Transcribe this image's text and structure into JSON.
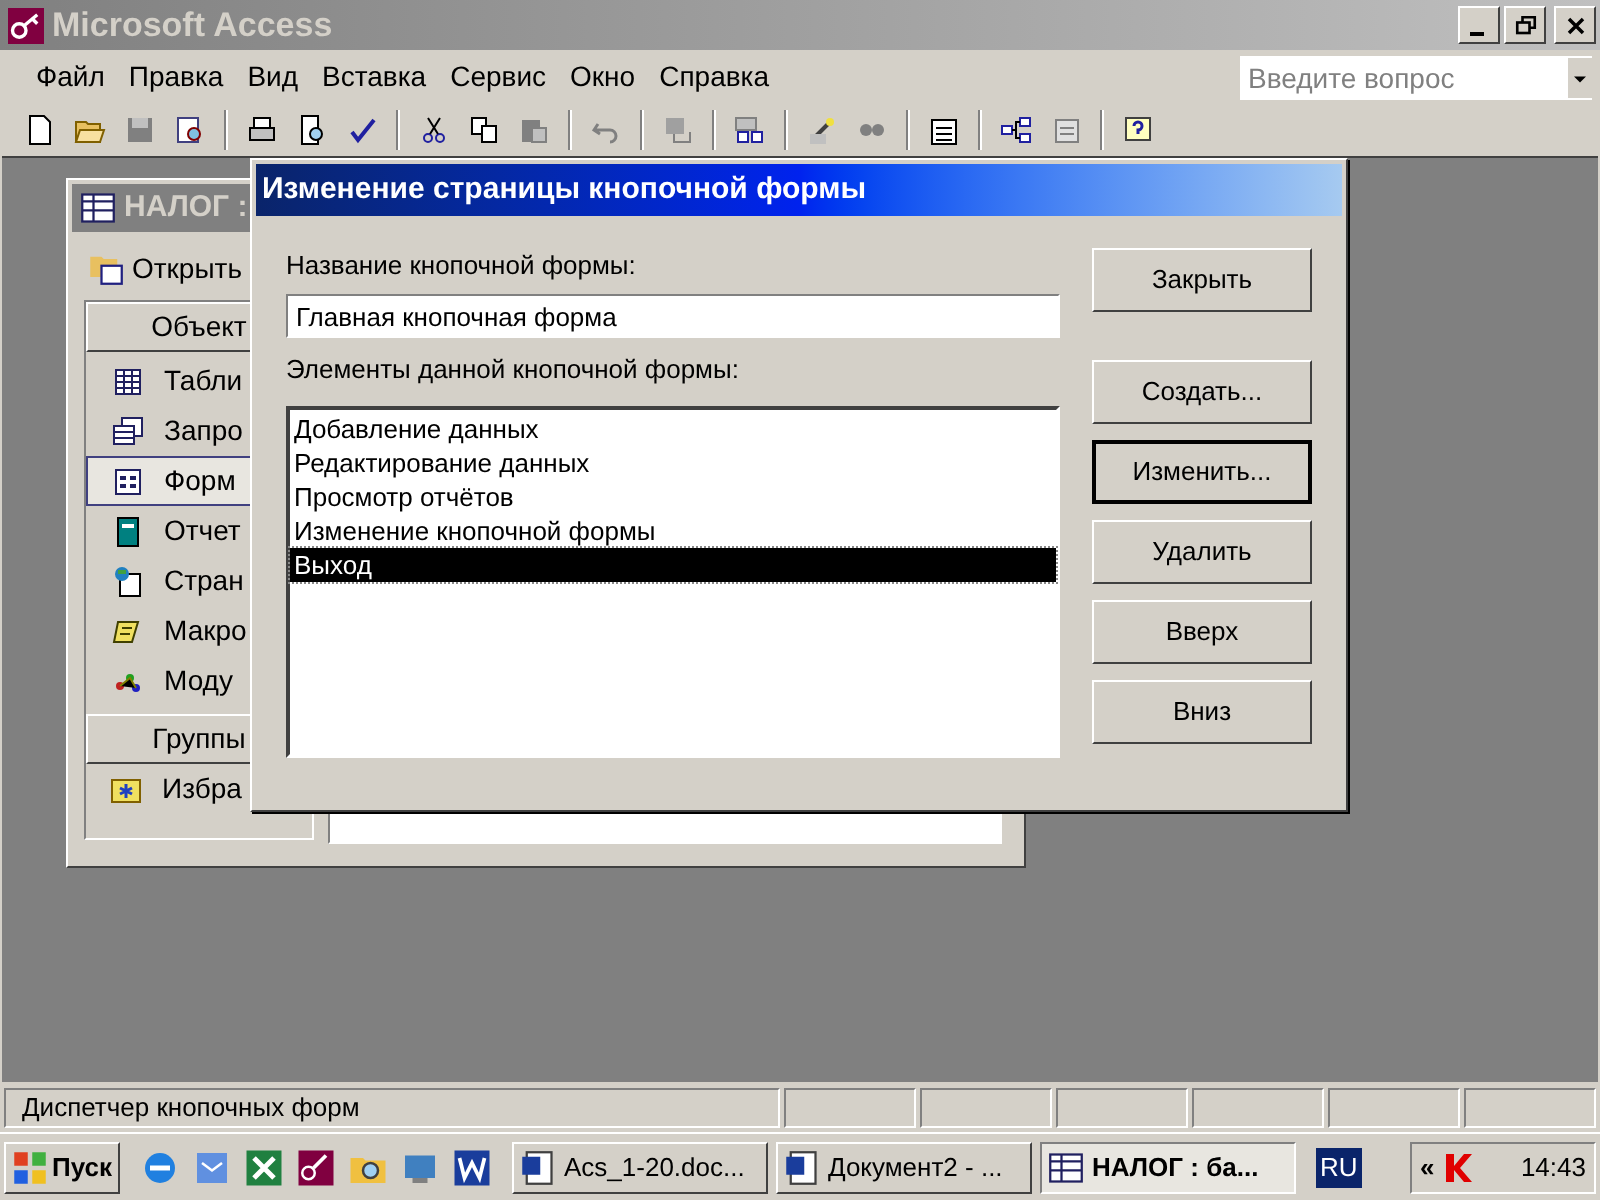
{
  "window": {
    "title": "Microsoft Access"
  },
  "menu": [
    {
      "label": "Файл"
    },
    {
      "label": "Правка"
    },
    {
      "label": "Вид"
    },
    {
      "label": "Вставка"
    },
    {
      "label": "Сервис"
    },
    {
      "label": "Окно"
    },
    {
      "label": "Справка"
    }
  ],
  "help_box": {
    "placeholder": "Введите вопрос"
  },
  "database_window": {
    "title": "НАЛОГ :",
    "open_button": "Открыть",
    "objects_header": "Объект",
    "objects": [
      {
        "label": "Табли",
        "kind": "table",
        "selected": false
      },
      {
        "label": "Запро",
        "kind": "query",
        "selected": false
      },
      {
        "label": "Форм",
        "kind": "form",
        "selected": true
      },
      {
        "label": "Отчет",
        "kind": "report",
        "selected": false
      },
      {
        "label": "Стран",
        "kind": "page",
        "selected": false
      },
      {
        "label": "Макро",
        "kind": "macro",
        "selected": false
      },
      {
        "label": "Моду",
        "kind": "module",
        "selected": false
      }
    ],
    "groups_header": "Группы",
    "groups": [
      {
        "label": "Избра"
      }
    ]
  },
  "dialog": {
    "title": "Изменение страницы кнопочной формы",
    "name_label": "Название кнопочной формы:",
    "name_value": "Главная кнопочная форма",
    "items_label": "Элементы данной кнопочной формы:",
    "items": [
      {
        "label": "Добавление данных",
        "selected": false
      },
      {
        "label": "Редактирование данных",
        "selected": false
      },
      {
        "label": "Просмотр отчётов",
        "selected": false
      },
      {
        "label": "Изменение кнопочной формы",
        "selected": false
      },
      {
        "label": "Выход",
        "selected": true
      }
    ],
    "buttons": [
      {
        "label": "Закрыть",
        "focused": false
      },
      {
        "label": "Создать...",
        "focused": false
      },
      {
        "label": "Изменить...",
        "focused": true
      },
      {
        "label": "Удалить",
        "focused": false
      },
      {
        "label": "Вверх",
        "focused": false
      },
      {
        "label": "Вниз",
        "focused": false
      }
    ]
  },
  "status_bar": {
    "text": "Диспетчер кнопочных форм"
  },
  "taskbar": {
    "start": "Пуск",
    "tasks": [
      {
        "label": "Acs_1-20.doc...",
        "selected": false
      },
      {
        "label": "Документ2 - ...",
        "selected": false
      },
      {
        "label": "НАЛОГ : ба...",
        "selected": true
      }
    ],
    "language": "RU",
    "tray_arrow": "«",
    "time": "14:43"
  }
}
